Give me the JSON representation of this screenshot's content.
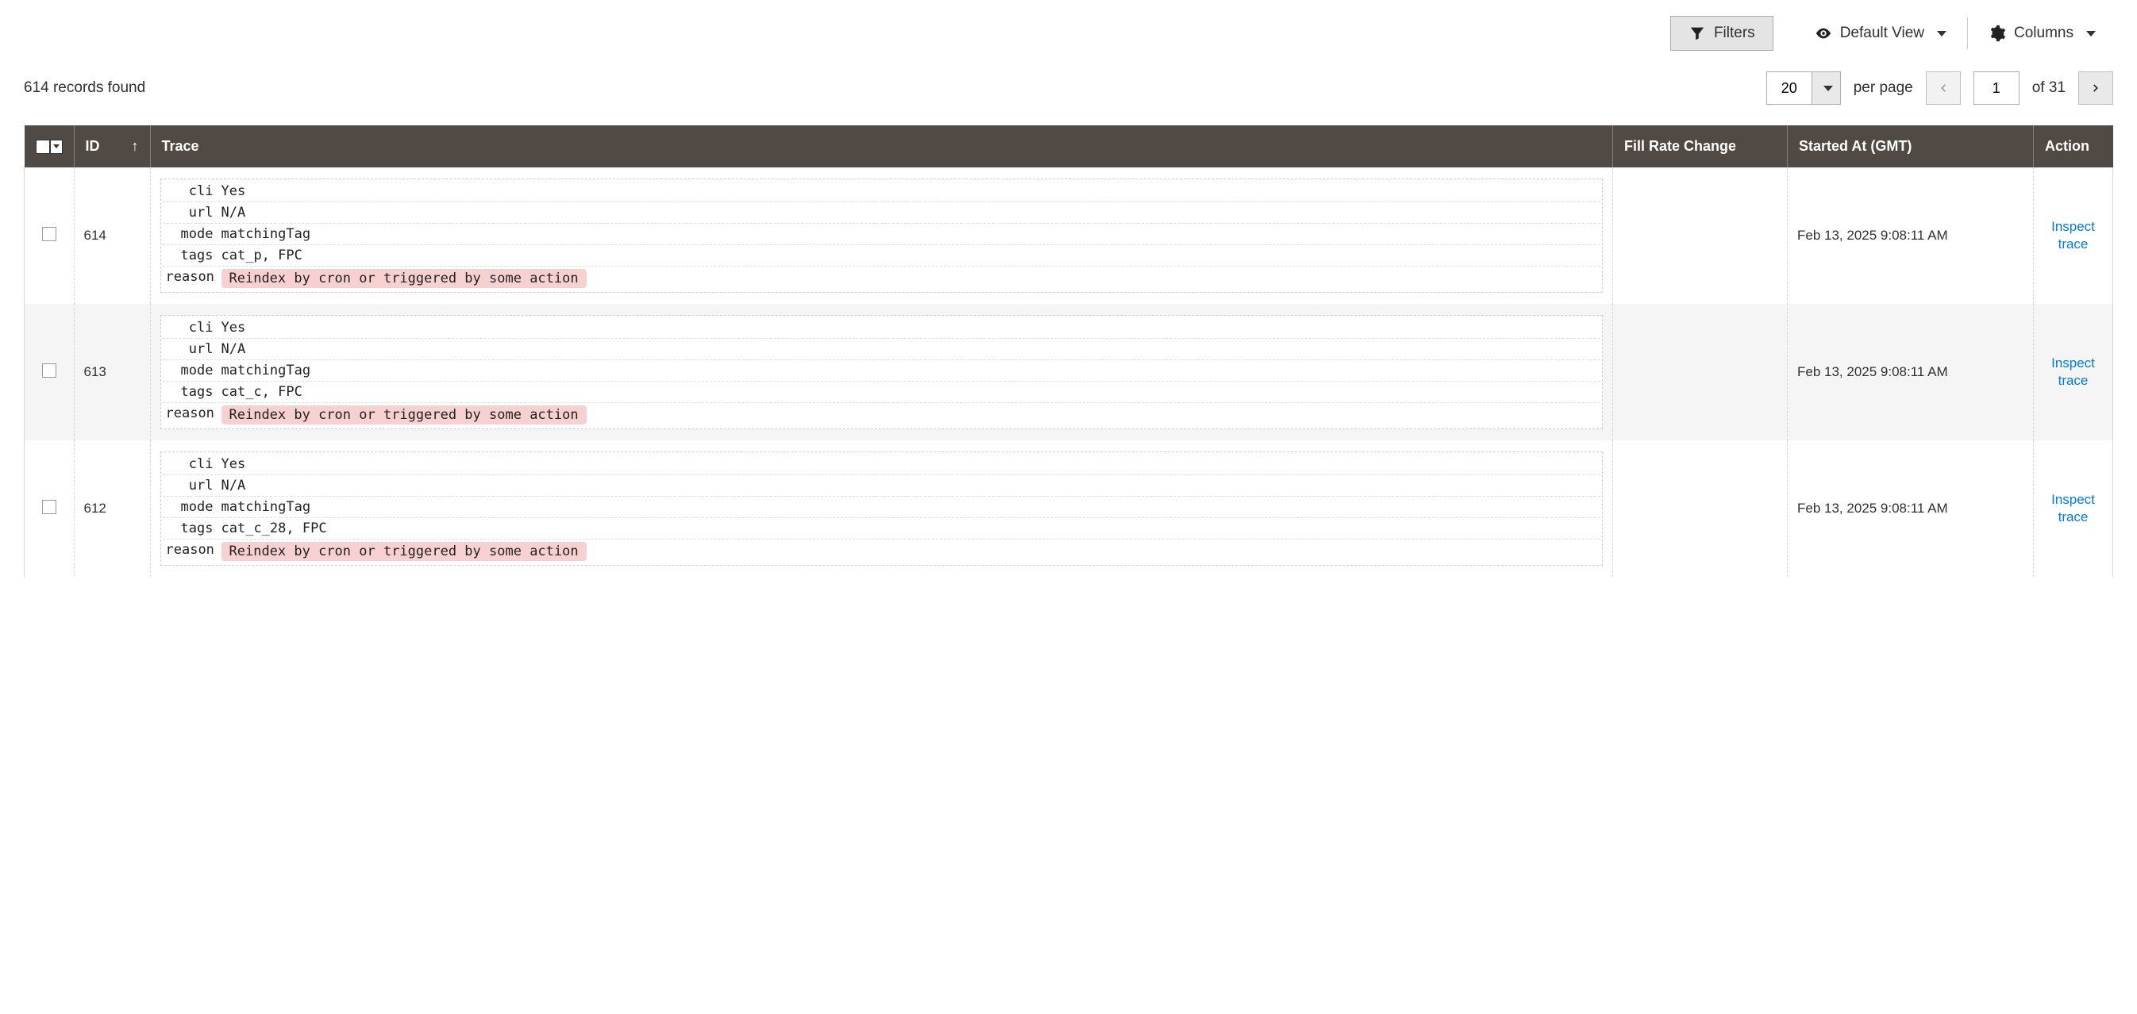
{
  "toolbar": {
    "filters_label": "Filters",
    "default_view_label": "Default View",
    "columns_label": "Columns"
  },
  "meta": {
    "records_found": "614 records found"
  },
  "pagination": {
    "per_page_value": "20",
    "per_page_label": "per page",
    "current_page": "1",
    "of_pages": "of 31"
  },
  "columns": {
    "id": "ID",
    "trace": "Trace",
    "fill_rate": "Fill Rate Change",
    "started_at": "Started At (GMT)",
    "action": "Action"
  },
  "action_link_label": "Inspect trace",
  "trace_keys": {
    "cli": "cli",
    "url": "url",
    "mode": "mode",
    "tags": "tags",
    "reason": "reason"
  },
  "rows": [
    {
      "id": "614",
      "cli": "Yes",
      "url": "N/A",
      "mode": "matchingTag",
      "tags": "cat_p, FPC",
      "reason": "Reindex by cron or triggered by some action",
      "fill_rate": "",
      "started_at": "Feb 13, 2025 9:08:11 AM"
    },
    {
      "id": "613",
      "cli": "Yes",
      "url": "N/A",
      "mode": "matchingTag",
      "tags": "cat_c, FPC",
      "reason": "Reindex by cron or triggered by some action",
      "fill_rate": "",
      "started_at": "Feb 13, 2025 9:08:11 AM"
    },
    {
      "id": "612",
      "cli": "Yes",
      "url": "N/A",
      "mode": "matchingTag",
      "tags": "cat_c_28, FPC",
      "reason": "Reindex by cron or triggered by some action",
      "fill_rate": "",
      "started_at": "Feb 13, 2025 9:08:11 AM"
    }
  ]
}
